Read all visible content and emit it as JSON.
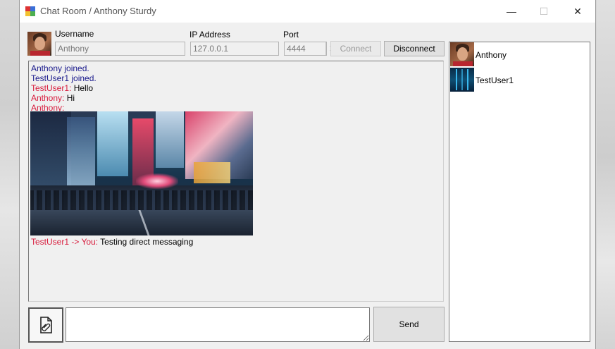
{
  "window": {
    "title": "Chat Room / Anthony Sturdy",
    "controls": {
      "minimize": "—",
      "maximize": "☐",
      "close": "✕"
    }
  },
  "connection": {
    "username_label": "Username",
    "username_value": "Anthony",
    "ip_label": "IP Address",
    "ip_value": "127.0.0.1",
    "port_label": "Port",
    "port_value": "4444",
    "connect_label": "Connect",
    "disconnect_label": "Disconnect"
  },
  "chat": {
    "messages": [
      {
        "text": "Anthony joined."
      },
      {
        "text": "TestUser1 joined."
      },
      {
        "sender": "TestUser1:",
        "text": " Hello"
      },
      {
        "sender": "Anthony:",
        "text": " Hi"
      },
      {
        "sender": "Anthony:",
        "text": ""
      },
      {
        "sender": "TestUser1 -> You:",
        "text": " Testing direct messaging"
      }
    ]
  },
  "compose": {
    "attach_icon": "attach-file-icon",
    "message_value": "",
    "send_label": "Send"
  },
  "users": [
    {
      "name": "Anthony"
    },
    {
      "name": "TestUser1"
    }
  ],
  "colors": {
    "system_message": "#1a1a8c",
    "sender_name": "#d81b3c",
    "window_bg": "#f0f0f0"
  }
}
